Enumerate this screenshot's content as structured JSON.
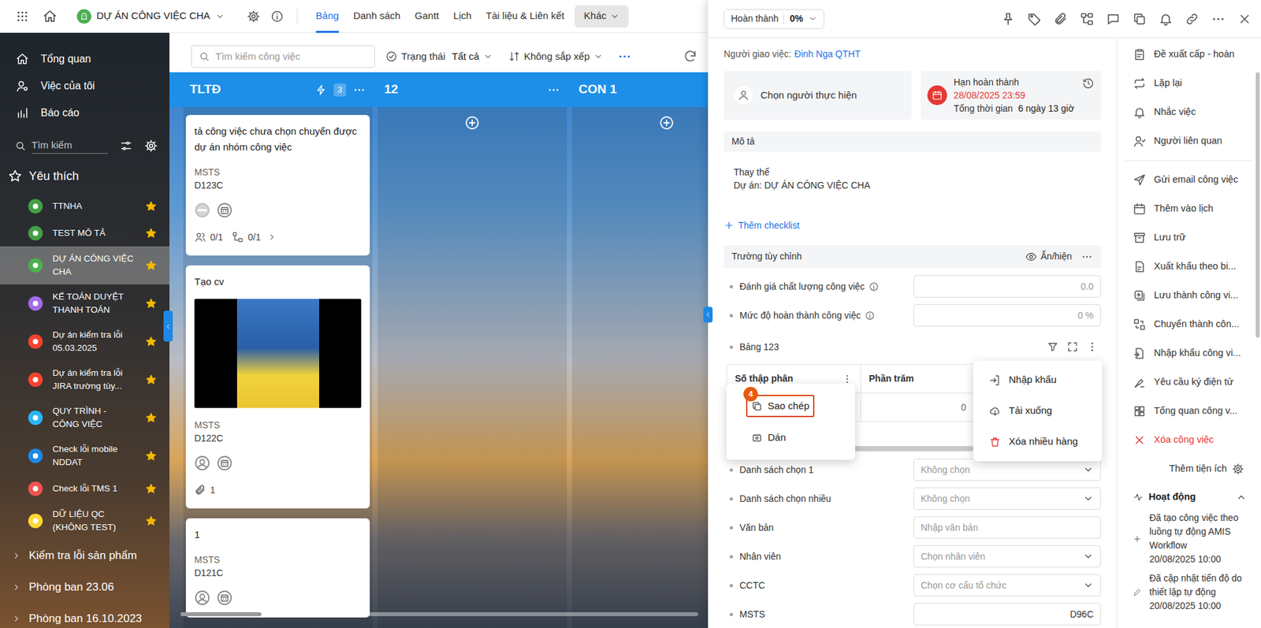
{
  "topbar": {
    "project": {
      "name": "DỰ ÁN CÔNG VIỆC CHA",
      "color": "#4caf50"
    },
    "tabs": [
      {
        "label": "Bảng",
        "selected": true
      },
      {
        "label": "Danh sách",
        "selected": false
      },
      {
        "label": "Gantt",
        "selected": false
      },
      {
        "label": "Lịch",
        "selected": false
      },
      {
        "label": "Tài liệu & Liên kết",
        "selected": false
      }
    ],
    "more": "Khác"
  },
  "sidebar": {
    "nav": [
      {
        "label": "Tổng quan"
      },
      {
        "label": "Việc của tôi"
      },
      {
        "label": "Báo cáo"
      }
    ],
    "search": {
      "placeholder": "Tìm kiếm"
    },
    "favorites_title": "Yêu thích",
    "favorites": [
      {
        "label": "TTNHA",
        "color": "#43a047",
        "selected": false,
        "starred": true
      },
      {
        "label": "TEST MÔ TẢ",
        "color": "#43a047",
        "selected": false,
        "starred": true
      },
      {
        "label": "DỰ ÁN CÔNG VIỆC CHA",
        "color": "#4caf50",
        "selected": true,
        "starred": true
      },
      {
        "label": "KẾ TOÁN DUYỆT THANH TOÁN",
        "color": "#a46be6",
        "selected": false,
        "starred": true
      },
      {
        "label": "Dự án kiểm tra lỗi 05.03.2025",
        "color": "#f4442e",
        "selected": false,
        "starred": true
      },
      {
        "label": "Dự án kiểm tra lỗi JIRA trường tùy...",
        "color": "#f4442e",
        "selected": false,
        "starred": true
      },
      {
        "label": "QUY TRÌNH - CÔNG VIỆC",
        "color": "#29b6f6",
        "selected": false,
        "starred": true
      },
      {
        "label": "Check lỗi mobile NDDAT",
        "color": "#1e88e5",
        "selected": false,
        "starred": true
      },
      {
        "label": "Check lỗi TMS 1",
        "color": "#ef5350",
        "selected": false,
        "starred": true
      },
      {
        "label": "DỮ LIỆU QC (KHÔNG TEST)",
        "color": "#fdd835",
        "selected": false,
        "starred": true
      }
    ],
    "groups": [
      {
        "label": "Kiểm tra lỗi sản phẩm",
        "expanded": false
      },
      {
        "label": "Phòng ban 23.06",
        "expanded": false
      },
      {
        "label": "Phòng ban 16.10.2023",
        "expanded": false
      }
    ]
  },
  "board": {
    "search": {
      "placeholder": "Tìm kiếm công việc"
    },
    "status_filter": {
      "label": "Trạng thái",
      "value": "Tất cả"
    },
    "sort": "Không sắp xếp",
    "columns": [
      {
        "title": "TLTĐ",
        "count": "3",
        "automation": true,
        "cards": [
          {
            "title": "tả công việc chưa chọn chuyển được dự án nhóm công việc",
            "project_code": "MSTS",
            "code": "D123C",
            "has_image": false,
            "assigned": true,
            "assignees": "0/1",
            "subtasks": "0/1"
          },
          {
            "title": "Tạo cv",
            "project_code": "MSTS",
            "code": "D122C",
            "has_image": true,
            "assigned": false,
            "attachments": "1"
          },
          {
            "title": "1",
            "project_code": "MSTS",
            "code": "D121C",
            "has_image": false,
            "assigned": false
          }
        ]
      },
      {
        "title": "12",
        "automation": false,
        "cards": []
      },
      {
        "title": "CON 1",
        "automation": false,
        "cards": []
      }
    ]
  },
  "detail": {
    "status": {
      "label": "Hoàn thành",
      "value": "0%"
    },
    "assigner": {
      "label": "Người giao việc:",
      "name": "Đinh Nga QTHT"
    },
    "assignee_placeholder": "Chọn người thực hiện",
    "deadline": {
      "label": "Hạn hoàn thành",
      "value": "28/08/2025 23:59",
      "total_label": "Tổng thời gian",
      "total": "6 ngày 13 giờ",
      "overdue": true
    },
    "description": {
      "title": "Mô tả",
      "lines": [
        "Thay thế",
        "Dự án: DỰ ÁN CÔNG VIỆC CHA"
      ]
    },
    "add_checklist": "Thêm checklist",
    "custom_fields": {
      "title": "Trường tùy chỉnh",
      "toggle": "Ẩn/hiện",
      "fields": [
        {
          "kind": "number",
          "label": "Đánh giá chất lượng công việc",
          "info": true,
          "value": "0.0"
        },
        {
          "kind": "number",
          "label": "Mức độ hoàn thành công việc",
          "info": true,
          "value": "0 %"
        },
        {
          "kind": "table",
          "label": "Bảng 123",
          "columns": [
            "Số thập phân",
            "Phần trăm"
          ],
          "rows": [
            [
              "",
              "0"
            ]
          ]
        },
        {
          "kind": "select",
          "label": "Danh sách chọn 1",
          "info": false,
          "placeholder": "Không chọn"
        },
        {
          "kind": "select",
          "label": "Danh sách chọn nhiều",
          "info": false,
          "placeholder": "Không chọn"
        },
        {
          "kind": "text",
          "label": "Văn bản",
          "info": false,
          "placeholder": "Nhập văn bản"
        },
        {
          "kind": "select",
          "label": "Nhân viên",
          "info": false,
          "placeholder": "Chọn nhân viên"
        },
        {
          "kind": "select",
          "label": "CCTC",
          "info": false,
          "placeholder": "Chọn cơ cấu tổ chức"
        },
        {
          "kind": "code",
          "label": "MSTS",
          "info": false,
          "value": "D96C"
        }
      ]
    }
  },
  "menus": {
    "column_menu": [
      {
        "label": "Sao chép",
        "highlighted": true,
        "badge": "4"
      },
      {
        "label": "Dán",
        "highlighted": false
      }
    ],
    "table_menu": [
      {
        "label": "Nhập khẩu",
        "danger": false
      },
      {
        "label": "Tải xuống",
        "danger": false
      },
      {
        "label": "Xóa nhiều hàng",
        "danger": true
      }
    ]
  },
  "actions": {
    "groups": [
      [
        {
          "label": "Đề xuất cấp - hoàn",
          "danger": false
        },
        {
          "label": "Lặp lại",
          "danger": false
        },
        {
          "label": "Nhắc việc",
          "danger": false
        },
        {
          "label": "Người liên quan",
          "danger": false
        }
      ],
      [
        {
          "label": "Gửi email công việc",
          "danger": false
        },
        {
          "label": "Thêm vào lịch",
          "danger": false
        },
        {
          "label": "Lưu trữ",
          "danger": false
        },
        {
          "label": "Xuất khẩu theo bi...",
          "danger": false
        },
        {
          "label": "Lưu thành công vi...",
          "danger": false
        },
        {
          "label": "Chuyển thành côn...",
          "danger": false
        },
        {
          "label": "Nhập khẩu công vi...",
          "danger": false
        },
        {
          "label": "Yêu cầu ký điện tử",
          "danger": false
        },
        {
          "label": "Tổng quan công v...",
          "danger": false
        },
        {
          "label": "Xóa công việc",
          "danger": true
        }
      ]
    ],
    "add_widget": "Thêm tiện ích"
  },
  "activity": {
    "title": "Hoạt động",
    "expanded": true,
    "items": [
      {
        "text": "Đã tạo công việc theo luồng tự động AMIS Workflow",
        "time": "20/08/2025 10:00"
      },
      {
        "text": "Đã cập nhật tiến độ do thiết lập tự động",
        "time": "20/08/2025 10:00"
      }
    ]
  }
}
